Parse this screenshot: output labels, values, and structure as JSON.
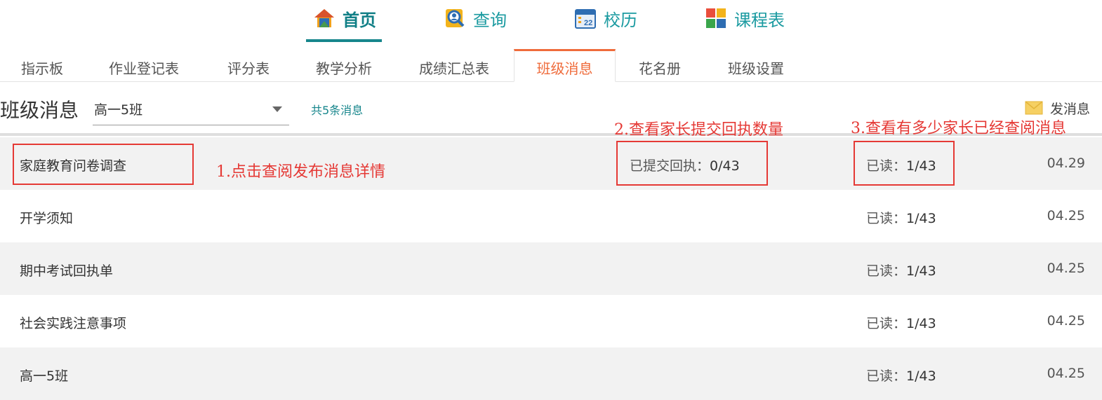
{
  "top_nav": [
    {
      "label": "首页",
      "icon": "home-icon",
      "active": true
    },
    {
      "label": "查询",
      "icon": "search-person-icon",
      "active": false
    },
    {
      "label": "校历",
      "icon": "calendar-icon",
      "active": false
    },
    {
      "label": "课程表",
      "icon": "grid-schedule-icon",
      "active": false
    }
  ],
  "tabs": [
    "指示板",
    "作业登记表",
    "评分表",
    "教学分析",
    "成绩汇总表",
    "班级消息",
    "花名册",
    "班级设置"
  ],
  "active_tab": "班级消息",
  "page": {
    "title": "班级消息",
    "class_select": "高一5班",
    "message_count": "共5条消息",
    "send_label": "发消息"
  },
  "messages": [
    {
      "title": "家庭教育问卷调查",
      "receipt_label": "已提交回执：",
      "receipt_value": "0/43",
      "read_label": "已读：",
      "read_value": "1/43",
      "date": "04.29"
    },
    {
      "title": "开学须知",
      "read_label": "已读：",
      "read_value": "1/43",
      "date": "04.25"
    },
    {
      "title": "期中考试回执单",
      "read_label": "已读：",
      "read_value": "1/43",
      "date": "04.25"
    },
    {
      "title": "社会实践注意事项",
      "read_label": "已读：",
      "read_value": "1/43",
      "date": "04.25"
    },
    {
      "title": "高一5班",
      "read_label": "已读：",
      "read_value": "1/43",
      "date": "04.25"
    }
  ],
  "annotations": {
    "note1": "1.点击查阅发布消息详情",
    "note2": "2.查看家长提交回执数量",
    "note3": "3.查看有多少家长已经查阅消息"
  },
  "colors": {
    "teal": "#17868c",
    "orange": "#ef6b3b",
    "annotation_red": "#e53935",
    "row_grey": "#f2f2f2"
  }
}
